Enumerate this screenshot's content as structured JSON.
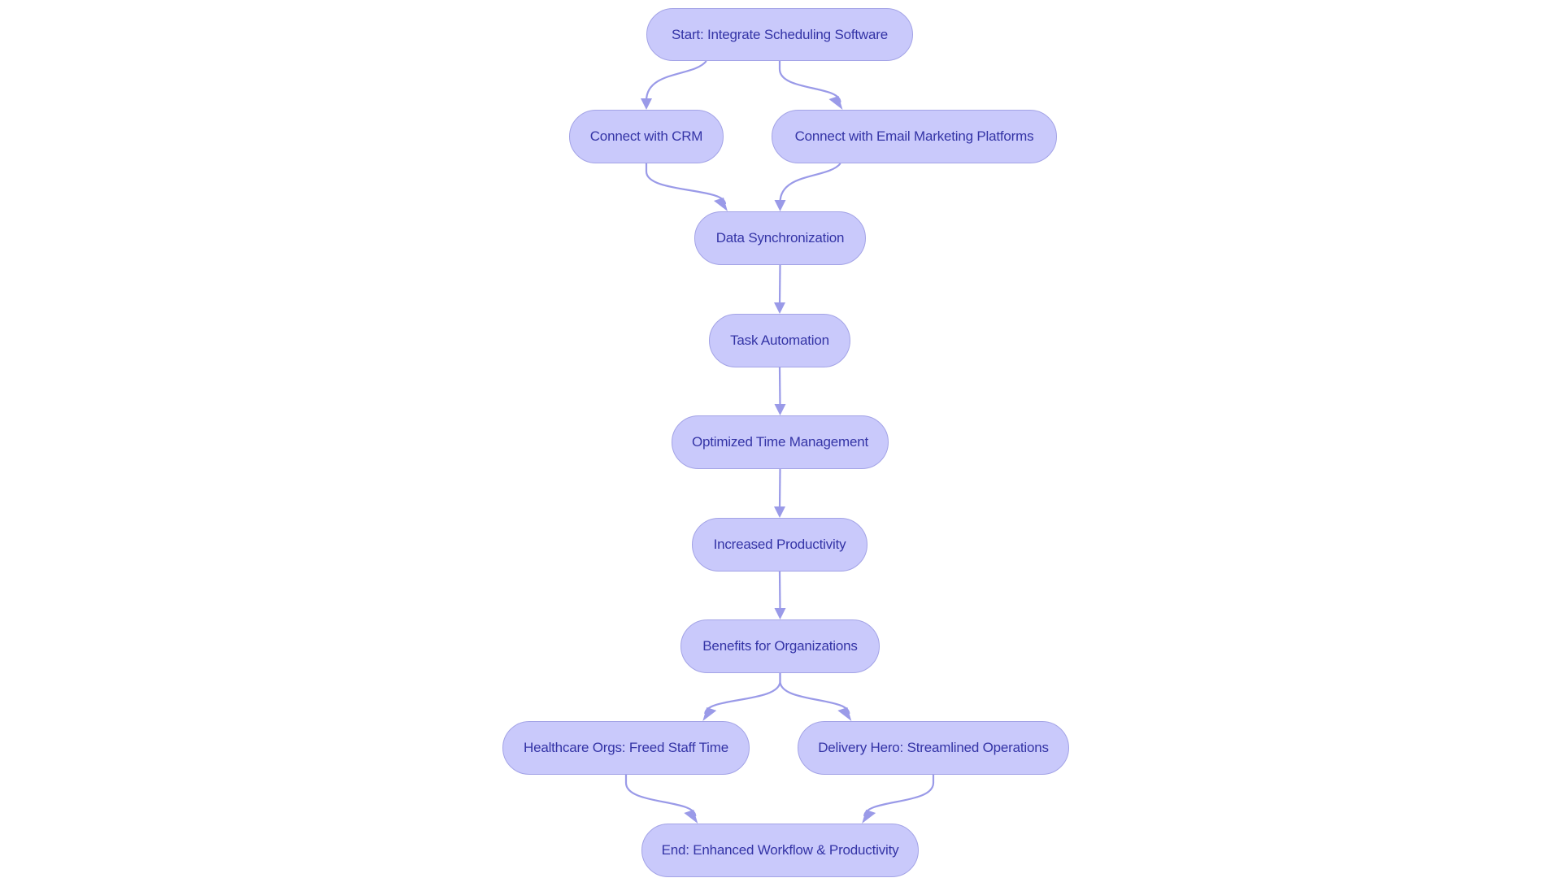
{
  "diagram": {
    "type": "flowchart",
    "direction": "top-down",
    "colors": {
      "node_fill": "#c9c9fb",
      "node_stroke": "#a3a3e6",
      "text": "#3434a6",
      "edge": "#9a9ae8"
    },
    "nodes": [
      {
        "id": "start",
        "label": "Start: Integrate Scheduling Software"
      },
      {
        "id": "crm",
        "label": "Connect with CRM"
      },
      {
        "id": "email",
        "label": "Connect with Email Marketing Platforms"
      },
      {
        "id": "sync",
        "label": "Data Synchronization"
      },
      {
        "id": "task",
        "label": "Task Automation"
      },
      {
        "id": "time",
        "label": "Optimized Time Management"
      },
      {
        "id": "prod",
        "label": "Increased Productivity"
      },
      {
        "id": "benefits",
        "label": "Benefits for Organizations"
      },
      {
        "id": "health",
        "label": "Healthcare Orgs: Freed Staff Time"
      },
      {
        "id": "delivery",
        "label": "Delivery Hero: Streamlined Operations"
      },
      {
        "id": "end",
        "label": "End: Enhanced Workflow & Productivity"
      }
    ],
    "edges": [
      {
        "from": "start",
        "to": "crm"
      },
      {
        "from": "start",
        "to": "email"
      },
      {
        "from": "crm",
        "to": "sync"
      },
      {
        "from": "email",
        "to": "sync"
      },
      {
        "from": "sync",
        "to": "task"
      },
      {
        "from": "task",
        "to": "time"
      },
      {
        "from": "time",
        "to": "prod"
      },
      {
        "from": "prod",
        "to": "benefits"
      },
      {
        "from": "benefits",
        "to": "health"
      },
      {
        "from": "benefits",
        "to": "delivery"
      },
      {
        "from": "health",
        "to": "end"
      },
      {
        "from": "delivery",
        "to": "end"
      }
    ]
  }
}
